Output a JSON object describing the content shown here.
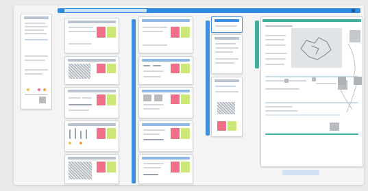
{
  "board": {
    "title": "",
    "background_color": "#f4f4f5",
    "accent_color": "#2f8be0"
  },
  "columns": [
    {
      "name": "left-thumbnail"
    },
    {
      "name": "column-1",
      "cards": 5
    },
    {
      "name": "column-2",
      "cards": 5
    },
    {
      "name": "column-3",
      "cards": 3
    },
    {
      "name": "detail-panel"
    }
  ],
  "colors": {
    "pink": "#f36f88",
    "green": "#cde879",
    "blue": "#3a8fdf",
    "teal": "#3fae9b"
  }
}
